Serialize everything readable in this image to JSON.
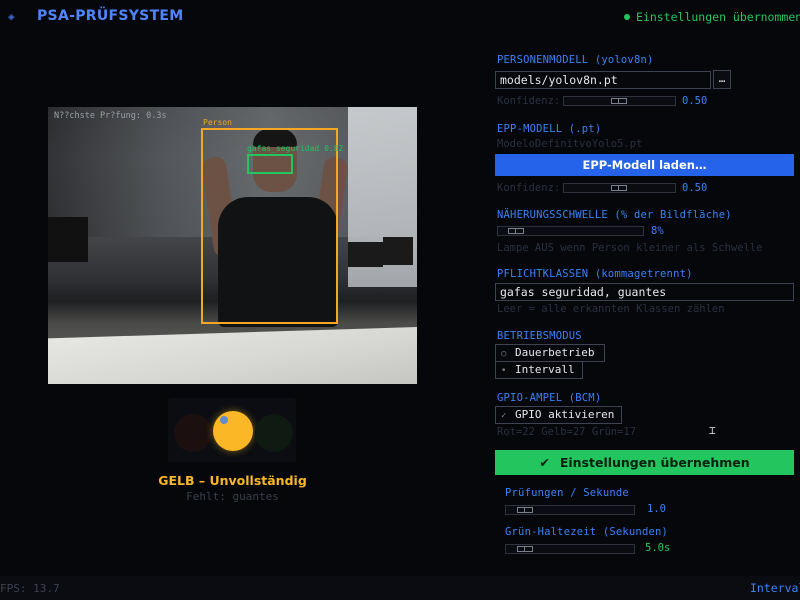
{
  "header": {
    "logo_icon": "diamond-icon",
    "title": "PSA-PRÜFSYSTEM",
    "status_text": "Einstellungen übernommen",
    "status_color": "#22c55e"
  },
  "camera": {
    "overlay_text": "N??chste Pr?fung: 0.3s",
    "person_label": "Person",
    "ppe_label": "gafas_seguridad 0.82"
  },
  "ampel": {
    "active_lamp": "yellow",
    "status": "GELB – Unvollständig",
    "missing": "Fehlt: guantes",
    "colors": {
      "red": "#ef4444",
      "yellow": "#fbb725",
      "green": "#22c55e"
    }
  },
  "panel": {
    "personenmodell": {
      "label": "PERSONENMODELL  (yolov8n)",
      "path": "models/yolov8n.pt",
      "browse_label": "…",
      "confidence_label": "Konfidenz:",
      "confidence_value": "0.50",
      "confidence_level": 0.5
    },
    "epp_modell": {
      "label": "EPP-MODELL  (.pt)",
      "path": "ModeloDefinitvoYolo5.pt",
      "load_button": "EPP-Modell laden…",
      "confidence_label": "Konfidenz:",
      "confidence_value": "0.50",
      "confidence_level": 0.5
    },
    "naeherung": {
      "label": "NÄHERUNGSSCHWELLE  (% der Bildfläche)",
      "value": "8%",
      "level": 0.08,
      "hint": "Lampe AUS wenn Person kleiner als Schwelle"
    },
    "pflichtklassen": {
      "label": "PFLICHTKLASSEN  (kommagetrennt)",
      "value": "gafas seguridad, guantes",
      "hint": "Leer = alle erkannten Klassen zählen"
    },
    "betriebsmodus": {
      "label": "BETRIEBSMODUS",
      "options": [
        "Dauerbetrieb",
        "Intervall"
      ],
      "selected": "Intervall"
    },
    "gpio": {
      "label": "GPIO-AMPEL  (BCM)",
      "checkbox_label": "GPIO aktivieren",
      "checked": true,
      "pins": "Rot=22  Gelb=27  Grün=17"
    },
    "apply_button": "Einstellungen übernehmen",
    "pruefungen": {
      "label": "Prüfungen / Sekunde",
      "value": "1.0",
      "level": 0.1
    },
    "gruen_haltezeit": {
      "label": "Grün-Haltezeit (Sekunden)",
      "value": "5.0s",
      "level": 0.1
    }
  },
  "footer": {
    "fps": "FPS: 13.7",
    "mode": "Intervall"
  }
}
